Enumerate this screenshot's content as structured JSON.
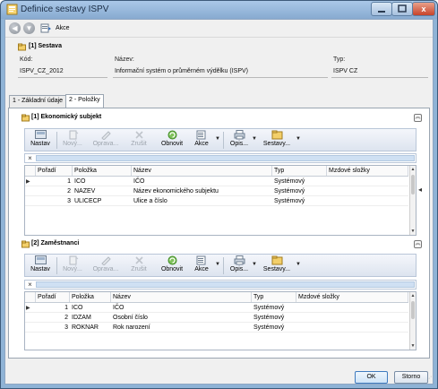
{
  "window": {
    "title": "Definice sestavy ISPV",
    "min_label": "",
    "max_label": "",
    "close_label": "x"
  },
  "action_bar": {
    "back_glyph": "◀",
    "forward_glyph": "▼",
    "akce_label": "Akce"
  },
  "sestava": {
    "header": "[1] Sestava",
    "fields": {
      "kod_label": "Kód:",
      "kod_value": "ISPV_CZ_2012",
      "nazev_label": "Název:",
      "nazev_value": "Informační systém o průměrném výdělku (ISPV)",
      "typ_label": "Typ:",
      "typ_value": "ISPV CZ"
    }
  },
  "tabs": [
    {
      "label": "1 - Základní údaje",
      "active": false
    },
    {
      "label": "2 - Položky",
      "active": true
    }
  ],
  "ribbon": {
    "nastav": "Nastav",
    "novy": "Nový...",
    "oprava": "Oprava...",
    "zrusit": "Zrušit",
    "obnovit": "Obnovit",
    "akce": "Akce",
    "opis": "Opis...",
    "sestavy": "Sestavy..."
  },
  "ekonomicky": {
    "header": "[1] Ekonomický subjekt",
    "columns": [
      "Pořadí",
      "Položka",
      "Název",
      "Typ",
      "Mzdové složky"
    ],
    "rows": [
      {
        "poradi": "1",
        "polozka": "ICO",
        "nazev": "IČO",
        "typ": "Systémový",
        "mzdove": ""
      },
      {
        "poradi": "2",
        "polozka": "NAZEV",
        "nazev": "Název ekonomického subjektu",
        "typ": "Systémový",
        "mzdove": ""
      },
      {
        "poradi": "3",
        "polozka": "ULICECP",
        "nazev": "Ulice a číslo",
        "typ": "Systémový",
        "mzdove": ""
      }
    ]
  },
  "zamestnanci": {
    "header": "[2] Zaměstnanci",
    "columns": [
      "Pořadí",
      "Položka",
      "Název",
      "Typ",
      "Mzdové složky"
    ],
    "rows": [
      {
        "poradi": "1",
        "polozka": "ICO",
        "nazev": "IČO",
        "typ": "Systémový",
        "mzdove": ""
      },
      {
        "poradi": "2",
        "polozka": "IDZAM",
        "nazev": "Osobní číslo",
        "typ": "Systémový",
        "mzdove": ""
      },
      {
        "poradi": "3",
        "polozka": "ROKNAR",
        "nazev": "Rok narození",
        "typ": "Systémový",
        "mzdove": ""
      }
    ]
  },
  "buttons": {
    "ok": "OK",
    "cancel": "Storno"
  },
  "colors": {
    "title_bar": "#87aad0",
    "close_button": "#c7432a",
    "ribbon": "#dde4ef",
    "filter_field": "#cfe0f3"
  }
}
